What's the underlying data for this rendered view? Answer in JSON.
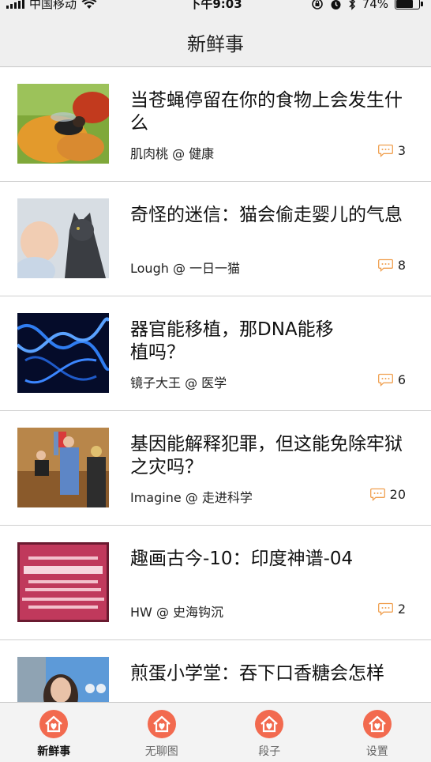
{
  "status_bar": {
    "carrier": "中国移动",
    "time": "下午9:03",
    "battery_text": "74%",
    "battery_level": 0.74
  },
  "nav": {
    "title": "新鲜事"
  },
  "feed": [
    {
      "title": "当苍蝇停留在你的食物上会发生什么",
      "meta": "肌肉桃 @ 健康",
      "comments": "3",
      "image": "fly-on-food"
    },
    {
      "title": "奇怪的迷信：猫会偷走婴儿的气息",
      "meta": "Lough @ 一日一猫",
      "comments": "8",
      "image": "baby-and-cat"
    },
    {
      "title": "器官能移植，那DNA能移植吗？",
      "meta": "镜子大王 @ 医学",
      "comments": "6",
      "image": "dna-helix"
    },
    {
      "title": "基因能解释犯罪，但这能免除牢狱之灾吗？",
      "meta": "Imagine @ 走进科学",
      "comments": "20",
      "image": "courtroom"
    },
    {
      "title": "趣画古今-10：印度神谱-04",
      "meta": "HW @ 史海钩沉",
      "comments": "2",
      "image": "pink-text-poster"
    },
    {
      "title": "煎蛋小学堂：吞下口香糖会怎样",
      "meta": "",
      "comments": "",
      "image": "woman-presenter"
    }
  ],
  "tabs": [
    {
      "label": "新鲜事",
      "icon": "home-icon",
      "active": true
    },
    {
      "label": "无聊图",
      "icon": "home-icon",
      "active": false
    },
    {
      "label": "段子",
      "icon": "home-icon",
      "active": false
    },
    {
      "label": "设置",
      "icon": "home-icon",
      "active": false
    }
  ],
  "colors": {
    "accent": "#f26a4f",
    "comment_icon": "#f0a050",
    "bar_bg": "#efefef"
  }
}
